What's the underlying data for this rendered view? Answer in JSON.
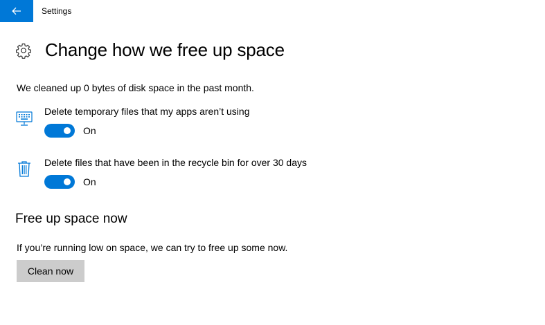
{
  "window": {
    "title": "Settings"
  },
  "page": {
    "title": "Change how we free up space",
    "summary": "We cleaned up 0 bytes of disk space in the past month."
  },
  "options": [
    {
      "label": "Delete temporary files that my apps aren’t using",
      "state": "On",
      "on": true,
      "icon": "keyboard-icon"
    },
    {
      "label": "Delete files that have been in the recycle bin for over 30 days",
      "state": "On",
      "on": true,
      "icon": "recycle-bin-icon"
    }
  ],
  "free_now": {
    "title": "Free up space now",
    "description": "If you’re running low on space, we can try to free up some now.",
    "button_label": "Clean now"
  },
  "colors": {
    "accent": "#0078d7",
    "button_bg": "#cccccc"
  }
}
